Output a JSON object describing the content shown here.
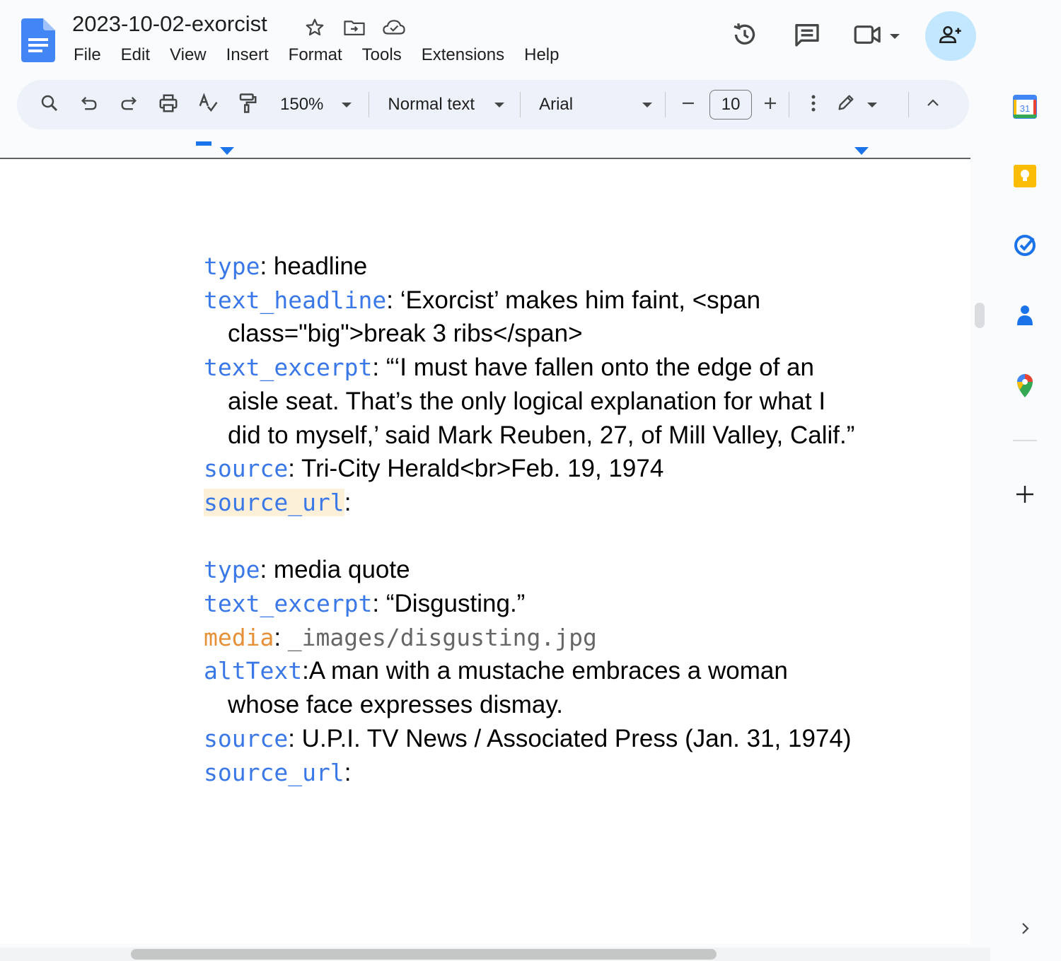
{
  "doc": {
    "title": "2023-10-02-exorcist"
  },
  "menu": [
    "File",
    "Edit",
    "View",
    "Insert",
    "Format",
    "Tools",
    "Extensions",
    "Help"
  ],
  "toolbar": {
    "zoom": "150%",
    "style": "Normal text",
    "font": "Arial",
    "font_size": "10"
  },
  "content": {
    "entry1": {
      "type_key": "type",
      "type_val": ": headline",
      "headline_key": "text_headline",
      "headline_val": ": ‘Exorcist’ makes him faint, <span",
      "headline_val2": "class=\"big\">break 3 ribs</span>",
      "excerpt_key": "text_excerpt",
      "excerpt_val1": ": “‘I must have fallen onto the edge of an",
      "excerpt_val2": "aisle seat. That’s the only logical explanation for what I",
      "excerpt_val3": "did to myself,’ said Mark Reuben, 27, of Mill Valley, Calif.”",
      "source_key": "source",
      "source_val": ": Tri-City Herald<br>Feb. 19, 1974",
      "source_url_key": "source_url",
      "source_url_val": ":"
    },
    "entry2": {
      "type_key": "type",
      "type_val": ": media quote",
      "excerpt_key": "text_excerpt",
      "excerpt_val": ": “Disgusting.”",
      "media_key": "media",
      "media_colon": ": ",
      "media_val": "_images/disgusting.jpg",
      "alt_key": "altText",
      "alt_val1": ":A man with a mustache embraces a woman",
      "alt_val2": "whose face expresses dismay.",
      "source_key": "source",
      "source_val": ": U.P.I. TV News / Associated Press (Jan. 31, 1974)",
      "source_url_key": "source_url",
      "source_url_val": ":"
    }
  },
  "sidebar": {
    "calendar_day": "31"
  },
  "colors": {
    "key_blue": "#3b78e7",
    "key_orange": "#e69138",
    "accent": "#1a73e8",
    "share_bg": "#c2e7ff"
  }
}
